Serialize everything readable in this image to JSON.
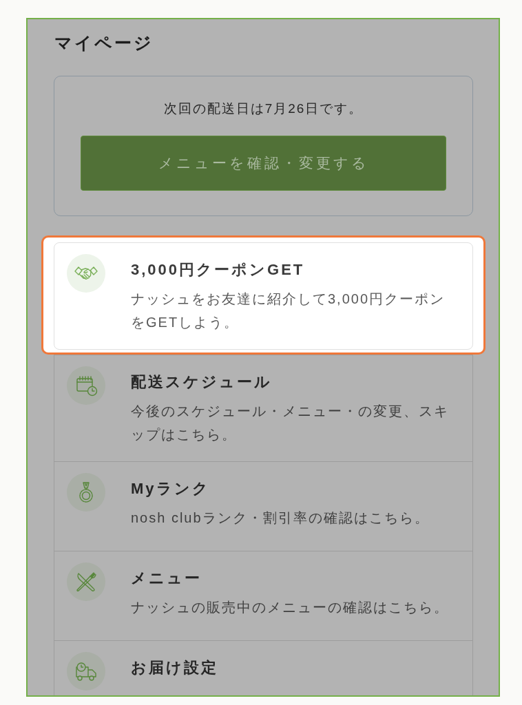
{
  "page": {
    "title": "マイページ"
  },
  "delivery": {
    "message": "次回の配送日は7月26日です。",
    "button": "メニューを確認・変更する"
  },
  "items": [
    {
      "kind": "coupon",
      "title": "3,000円クーポンGET",
      "description": "ナッシュをお友達に紹介して3,000円クーポンをGETしよう。",
      "highlighted": true
    },
    {
      "kind": "schedule",
      "title": "配送スケジュール",
      "description": "今後のスケジュール・メニュー・の変更、スキップはこちら。",
      "highlighted": false
    },
    {
      "kind": "rank",
      "title": "Myランク",
      "description": "nosh clubランク・割引率の確認はこちら。",
      "highlighted": false
    },
    {
      "kind": "menu",
      "title": "メニュー",
      "description": "ナッシュの販売中のメニューの確認はこちら。",
      "highlighted": false
    },
    {
      "kind": "delivery_settings",
      "title": "お届け設定",
      "highlighted": false
    }
  ]
}
